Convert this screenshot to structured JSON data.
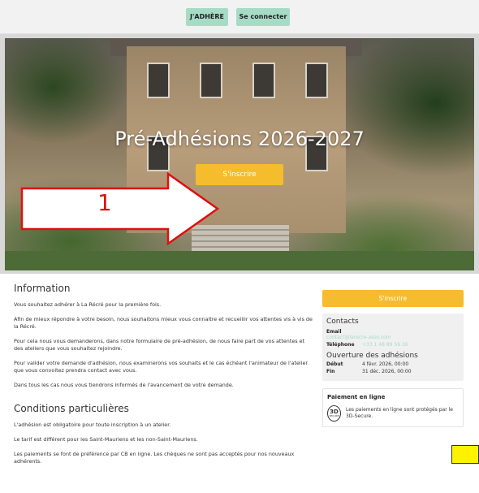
{
  "topbar": {
    "join_label": "J'ADHÈRE",
    "login_label": "Se connecter"
  },
  "hero": {
    "title": "Pré-Adhésions 2026-2027",
    "cta_label": "S'inscrire"
  },
  "annotation": {
    "step_number": "1",
    "arrow_color": "#e01010"
  },
  "information": {
    "heading": "Information",
    "paragraphs": [
      "Vous souhaitez adhérer à La Récré pour la première fois.",
      "Afin de mieux répondre à votre besoin, nous souhaitons mieux vous connaitre et recueillir vos attentes vis à vis de la Récré.",
      "Pour cela nous vous demanderons, dans notre formulaire de pré-adhésion, de nous faire part de vos attentes et des ateliers que vous souhaitez rejoindre.",
      "Pour valider votre demande d'adhésion, nous examinerons vos souhaits et le cas échéant l'animateur de l'atelier que vous convoitez prendra contact avec vous.",
      "Dans tous les cas nous vous tiendrons informés de l'avancement de votre demande."
    ]
  },
  "conditions": {
    "heading": "Conditions particulières",
    "paragraphs": [
      "L'adhésion est obligatoire pour toute inscription à un atelier.",
      "Le tarif est différent pour les Saint-Mauriens et les non-Saint-Mauriens.",
      "Les paiements se font de préférence par CB en ligne. Les chèques ne sont pas acceptés pour nos nouveaux adhérents."
    ]
  },
  "sidebar": {
    "cta_label": "S'inscrire",
    "contacts": {
      "heading": "Contacts",
      "email_label": "Email",
      "email_value": "contact@larecre-asso.com",
      "phone_label": "Téléphone",
      "phone_value": "+33 1 48 89 56 36"
    },
    "opening": {
      "heading": "Ouverture des adhésions",
      "start_label": "Début",
      "start_value": "4 févr. 2026, 00:00",
      "end_label": "Fin",
      "end_value": "31 déc. 2026, 00:00"
    },
    "payment": {
      "heading": "Paiement en ligne",
      "badge_main": "3D",
      "badge_sub": "SECURE",
      "text": "Les paiements en ligne sont protégés par le 3D-Secure."
    }
  },
  "colors": {
    "accent_yellow": "#f5bd2d",
    "mint_button": "#a6dcc6",
    "highlight_box": "#fff200"
  }
}
